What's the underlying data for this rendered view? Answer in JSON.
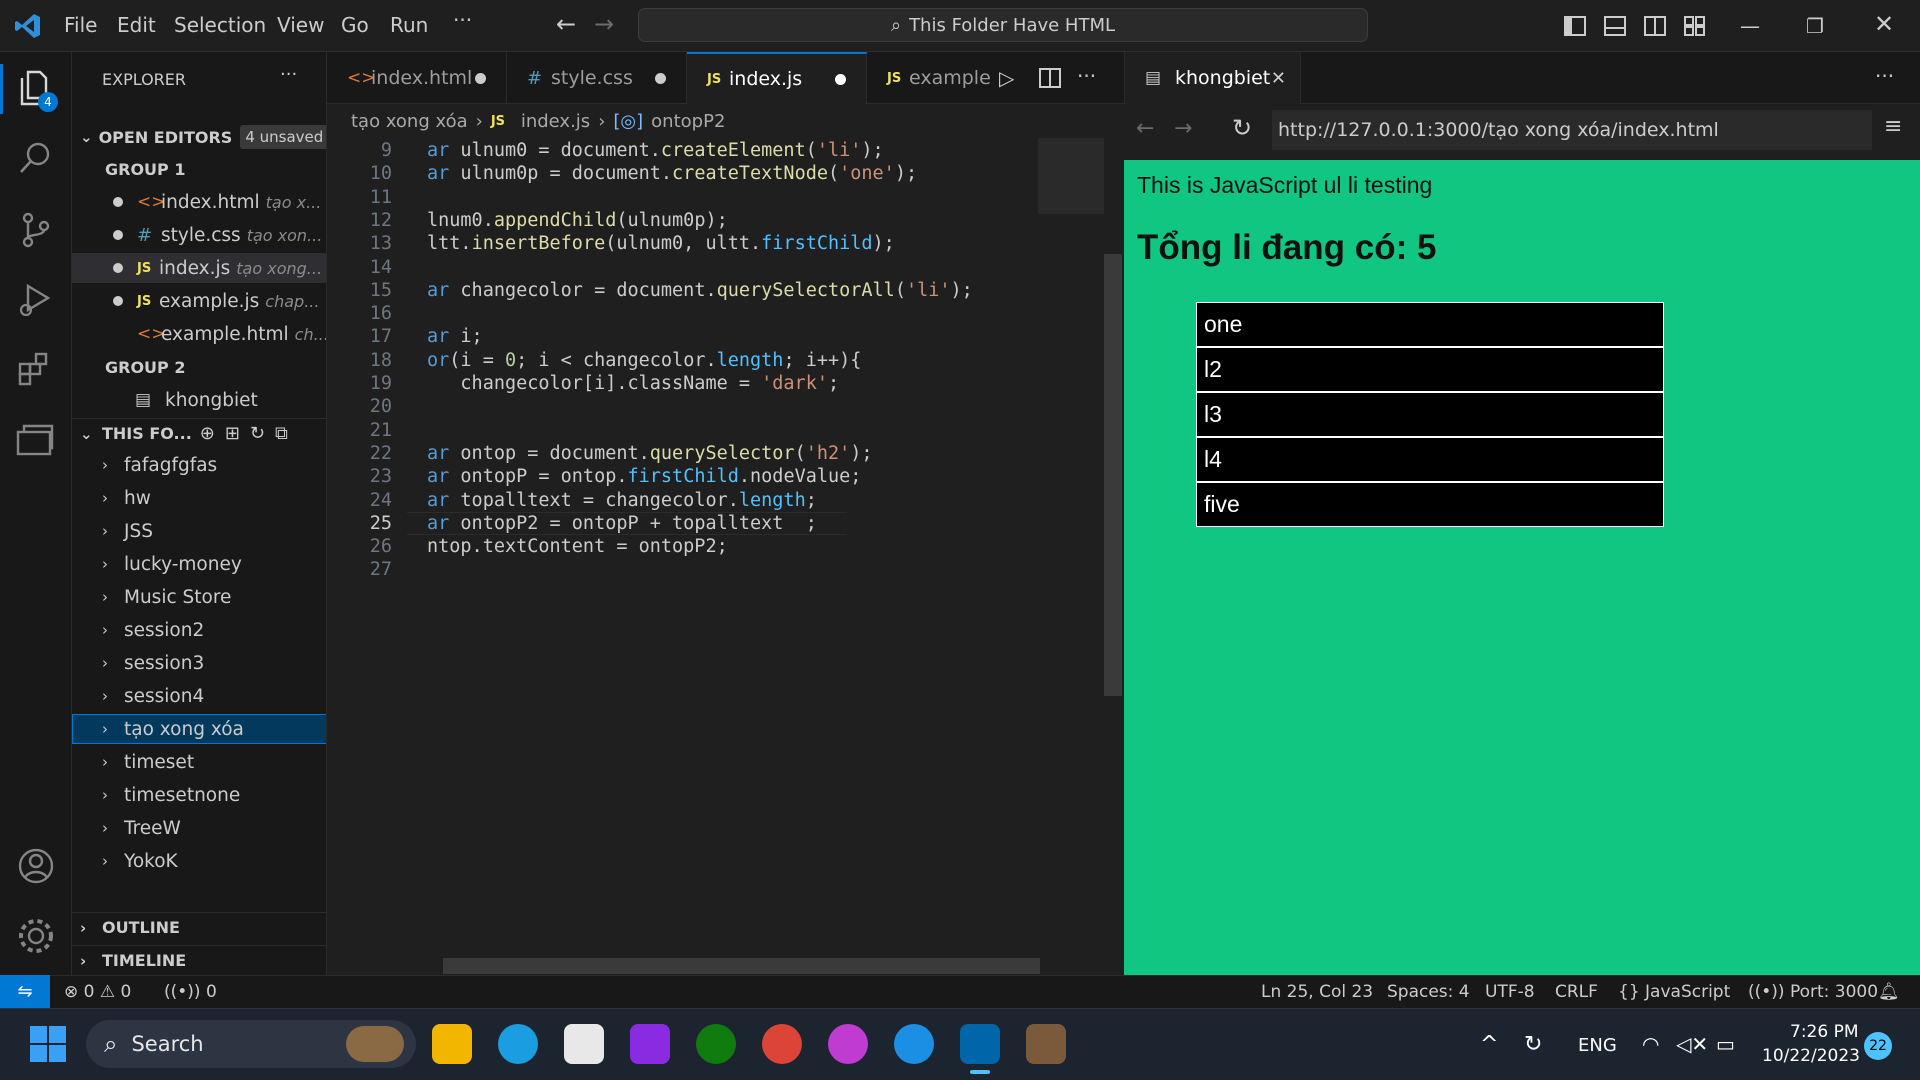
{
  "menu": [
    "File",
    "Edit",
    "Selection",
    "View",
    "Go",
    "Run"
  ],
  "command_center": "This Folder Have HTML",
  "activity": {
    "explorer_badge": "4"
  },
  "explorer": {
    "title": "EXPLORER",
    "open_editors": "OPEN EDITORS",
    "unsaved_badge": "4 unsaved",
    "group1": "GROUP 1",
    "group2": "GROUP 2",
    "editors": [
      {
        "name": "index.html",
        "desc": "tạo x..."
      },
      {
        "name": "style.css",
        "desc": "tạo xon..."
      },
      {
        "name": "index.js",
        "desc": "tạo xong..."
      },
      {
        "name": "example.js",
        "desc": "chap..."
      },
      {
        "name": "example.html",
        "desc": "ch..."
      }
    ],
    "group2_item": "khongbiet",
    "folder_title": "THIS FO...",
    "folders": [
      "fafagfgfas",
      "hw",
      "JSS",
      "lucky-money",
      "Music Store",
      "session2",
      "session3",
      "session4",
      "tạo xong xóa",
      "timeset",
      "timesetnone",
      "TreeW",
      "YokoK"
    ],
    "outline": "OUTLINE",
    "timeline": "TIMELINE"
  },
  "tabs": [
    {
      "label": "index.html"
    },
    {
      "label": "style.css"
    },
    {
      "label": "index.js"
    },
    {
      "label": "example"
    }
  ],
  "breadcrumb": {
    "folder": "tạo xong xóa",
    "file": "index.js",
    "symbol": "ontopP2"
  },
  "code_lines": [
    {
      "n": "9",
      "text": "ar ulnum0 = document.createElement('li');"
    },
    {
      "n": "10",
      "text": "ar ulnum0p = document.createTextNode('one');"
    },
    {
      "n": "11",
      "text": ""
    },
    {
      "n": "12",
      "text": "lnum0.appendChild(ulnum0p);"
    },
    {
      "n": "13",
      "text": "ltt.insertBefore(ulnum0, ultt.firstChild);"
    },
    {
      "n": "14",
      "text": ""
    },
    {
      "n": "15",
      "text": "ar changecolor = document.querySelectorAll('li');"
    },
    {
      "n": "16",
      "text": ""
    },
    {
      "n": "17",
      "text": "ar i;"
    },
    {
      "n": "18",
      "text": "or(i = 0; i < changecolor.length; i++){"
    },
    {
      "n": "19",
      "text": "   changecolor[i].className = 'dark';"
    },
    {
      "n": "20",
      "text": ""
    },
    {
      "n": "21",
      "text": ""
    },
    {
      "n": "22",
      "text": "ar ontop = document.querySelector('h2');"
    },
    {
      "n": "23",
      "text": "ar ontopP = ontop.firstChild.nodeValue;"
    },
    {
      "n": "24",
      "text": "ar topalltext = changecolor.length;"
    },
    {
      "n": "25",
      "text": "ar ontopP2 = ontopP + topalltext  ;"
    },
    {
      "n": "26",
      "text": "ntop.textContent = ontopP2;"
    },
    {
      "n": "27",
      "text": ""
    }
  ],
  "browser": {
    "tab": "khongbiet",
    "url": "http://127.0.0.1:3000/tạo xong xóa/index.html",
    "paragraph": "This is JavaScript ul li testing",
    "heading": "Tổng li đang có: 5",
    "items": [
      "one",
      "l2",
      "l3",
      "l4",
      "five"
    ]
  },
  "statusbar": {
    "errors": "0",
    "warnings": "0",
    "ports": "0",
    "position": "Ln 25, Col 23",
    "spaces": "Spaces: 4",
    "encoding": "UTF-8",
    "eol": "CRLF",
    "language": "JavaScript",
    "port": "Port: 3000"
  },
  "taskbar": {
    "search": "Search",
    "lang": "ENG",
    "time": "7:26 PM",
    "date": "10/22/2023",
    "notif": "22"
  }
}
